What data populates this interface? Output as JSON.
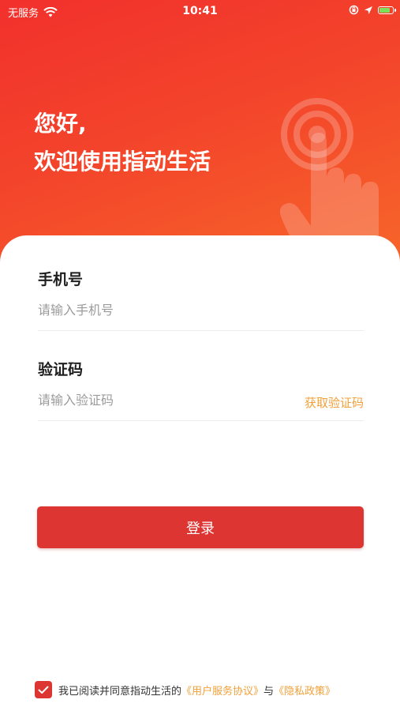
{
  "status_bar": {
    "carrier": "无服务",
    "time": "10:41",
    "icons": [
      "wifi-icon",
      "orientation-lock-icon",
      "location-arrow-icon",
      "battery-charging-icon"
    ]
  },
  "hero": {
    "greeting_line1": "您好,",
    "greeting_line2": "欢迎使用指动生活",
    "graphic": "tap-hand-icon"
  },
  "form": {
    "phone_label": "手机号",
    "phone_placeholder": "请输入手机号",
    "phone_value": "",
    "code_label": "验证码",
    "code_placeholder": "请输入验证码",
    "code_value": "",
    "get_code_label": "获取验证码"
  },
  "login_button": "登录",
  "agreement": {
    "checked": true,
    "prefix": "我已阅读并同意指动生活的",
    "terms_link": "《用户服务协议》",
    "conjunction": "与",
    "privacy_link": "《隐私政策》"
  },
  "colors": {
    "primary": "#dd3531",
    "accent": "#f2a039",
    "hero_gradient_start": "#f2302c",
    "hero_gradient_end": "#f7662a"
  }
}
